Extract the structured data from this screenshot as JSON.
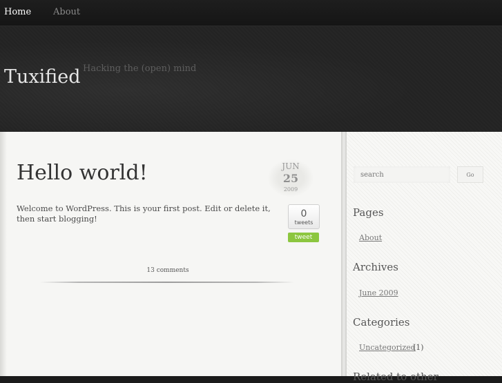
{
  "nav": {
    "home": "Home",
    "about": "About"
  },
  "header": {
    "site_title": "Tuxified",
    "tagline": "Hacking the (open) mind"
  },
  "post": {
    "title": "Hello world!",
    "date": {
      "month": "JUN",
      "day": "25",
      "year": "2009"
    },
    "body": "Welcome to WordPress. This is your first post. Edit or delete it, then start blogging!",
    "tweets": {
      "count": "0",
      "label": "tweets",
      "button": "tweet"
    },
    "comments": "13 comments"
  },
  "sidebar": {
    "search": {
      "placeholder": "search",
      "button": "Go"
    },
    "pages": {
      "title": "Pages",
      "items": [
        "About"
      ]
    },
    "archives": {
      "title": "Archives",
      "items": [
        "June 2009"
      ]
    },
    "categories": {
      "title": "Categories",
      "items": [
        {
          "name": "Uncategorized",
          "count": "(1)"
        }
      ]
    },
    "related": {
      "title": "Related to other"
    }
  },
  "colors": {
    "accent_green": "#8cc63f",
    "nav_bg": "#1b1b1b",
    "content_bg": "#f6f6f4"
  }
}
